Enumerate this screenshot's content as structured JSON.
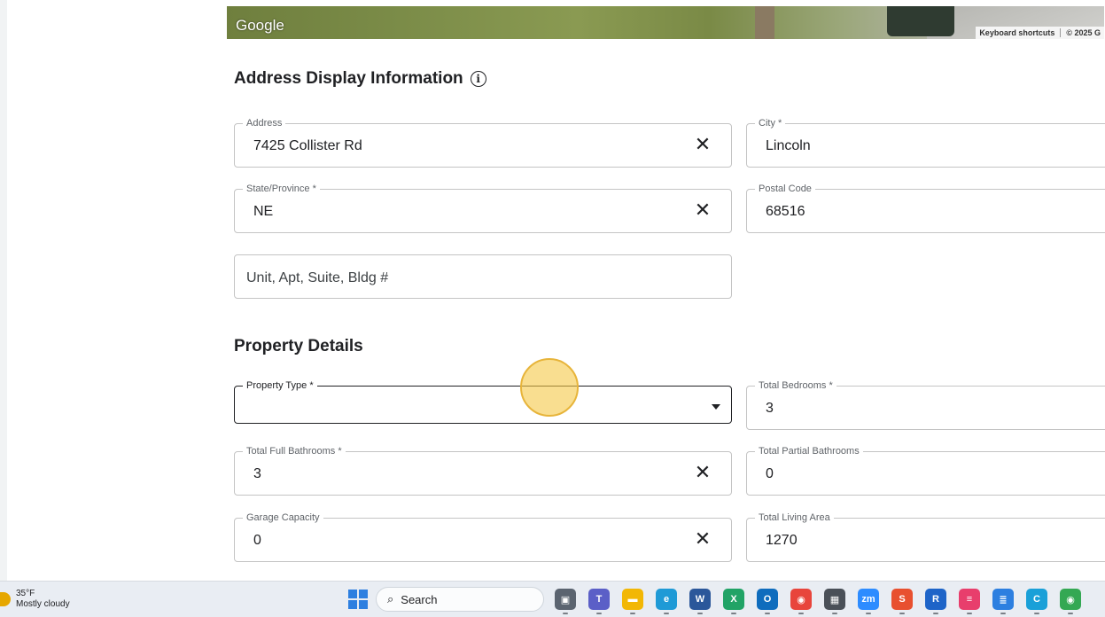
{
  "map": {
    "logo_text": "Google",
    "shortcuts_text": "Keyboard shortcuts",
    "copyright_text": "© 2025 G"
  },
  "address_section": {
    "title": "Address Display Information",
    "info_icon_glyph": "i",
    "fields": {
      "address": {
        "label": "Address",
        "value": "7425 Collister Rd"
      },
      "city": {
        "label": "City *",
        "value": "Lincoln"
      },
      "state": {
        "label": "State/Province *",
        "value": "NE"
      },
      "postal": {
        "label": "Postal Code",
        "value": "68516"
      },
      "unit": {
        "placeholder": "Unit, Apt, Suite, Bldg #"
      }
    }
  },
  "property_section": {
    "title": "Property Details",
    "fields": {
      "property_type": {
        "label": "Property Type *",
        "value": ""
      },
      "bedrooms": {
        "label": "Total Bedrooms *",
        "value": "3"
      },
      "full_baths": {
        "label": "Total Full Bathrooms *",
        "value": "3"
      },
      "partial_baths": {
        "label": "Total Partial Bathrooms",
        "value": "0"
      },
      "garage": {
        "label": "Garage Capacity",
        "value": "0"
      },
      "living_area": {
        "label": "Total Living Area",
        "value": "1270"
      }
    }
  },
  "clear_glyph": "✕",
  "taskbar": {
    "weather_temp": "35°F",
    "weather_desc": "Mostly cloudy",
    "search_label": "Search",
    "apps": [
      {
        "name": "task-view",
        "color": "#5b6470",
        "glyph": "▣"
      },
      {
        "name": "teams",
        "color": "#5b5fc7",
        "glyph": "T"
      },
      {
        "name": "file-explorer",
        "color": "#f2b705",
        "glyph": "▬"
      },
      {
        "name": "edge",
        "color": "#1f9ad6",
        "glyph": "e"
      },
      {
        "name": "word",
        "color": "#2b579a",
        "glyph": "W"
      },
      {
        "name": "excel",
        "color": "#21a366",
        "glyph": "X"
      },
      {
        "name": "outlook",
        "color": "#0f6cbd",
        "glyph": "O"
      },
      {
        "name": "chrome",
        "color": "#e8453c",
        "glyph": "◉"
      },
      {
        "name": "calculator",
        "color": "#4a5058",
        "glyph": "▦"
      },
      {
        "name": "zoom",
        "color": "#2d8cff",
        "glyph": "zm"
      },
      {
        "name": "app-s",
        "color": "#e8502f",
        "glyph": "S"
      },
      {
        "name": "app-r",
        "color": "#1e64c8",
        "glyph": "R"
      },
      {
        "name": "app-pink",
        "color": "#e83e6c",
        "glyph": "≡"
      },
      {
        "name": "app-doc",
        "color": "#2d7fe0",
        "glyph": "≣"
      },
      {
        "name": "app-c",
        "color": "#1aa0d8",
        "glyph": "C"
      },
      {
        "name": "chrome-2",
        "color": "#34a853",
        "glyph": "◉"
      }
    ]
  }
}
